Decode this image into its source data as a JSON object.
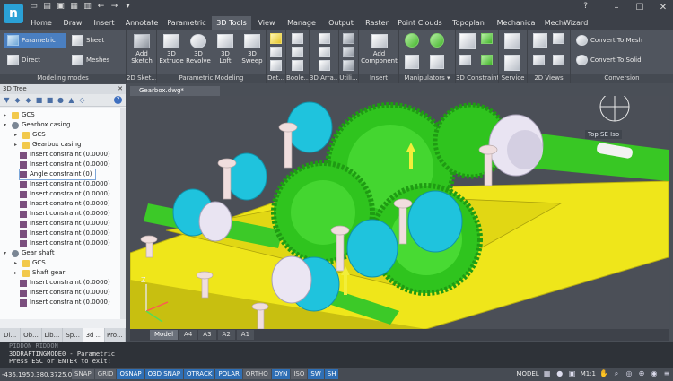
{
  "title_bar": {
    "help_label": "?",
    "qat_icons": [
      "new-file-icon",
      "open-icon",
      "save-icon",
      "save-as-icon",
      "print-icon",
      "undo-icon",
      "redo-icon",
      "dropdown-icon"
    ]
  },
  "tabs": [
    {
      "label": "Home"
    },
    {
      "label": "Draw"
    },
    {
      "label": "Insert"
    },
    {
      "label": "Annotate"
    },
    {
      "label": "Parametric"
    },
    {
      "label": "3D Tools"
    },
    {
      "label": "View"
    },
    {
      "label": "Manage"
    },
    {
      "label": "Output"
    },
    {
      "label": "Raster"
    },
    {
      "label": "Point Clouds"
    },
    {
      "label": "Topoplan"
    },
    {
      "label": "Mechanica"
    },
    {
      "label": "MechWizard"
    }
  ],
  "ribbon": {
    "modeling_modes": {
      "label": "Modeling modes",
      "parametric": "Parametric",
      "direct": "Direct",
      "sheet": "Sheet",
      "meshes": "Meshes"
    },
    "sketch": {
      "label": "2D Sket...",
      "add_sketch": "Add\nSketch"
    },
    "param_modeling": {
      "label": "Parametric Modeling",
      "extrude": "3D\nExtrude",
      "revolve": "3D\nRevolve",
      "loft": "3D\nLoft",
      "sweep": "3D\nSweep"
    },
    "detail": {
      "label": "Det..."
    },
    "boolean": {
      "label": "Boole..."
    },
    "array": {
      "label": "3D Arra..."
    },
    "util": {
      "label": "Utili..."
    },
    "insert": {
      "label": "Insert",
      "add_component": "Add\nComponent"
    },
    "manipulators": {
      "label": "Manipulators"
    },
    "constraint": {
      "label": "3D Constraint"
    },
    "service": {
      "label": "Service"
    },
    "views": {
      "label": "2D Views"
    },
    "conversion": {
      "label": "Conversion",
      "to_mesh": "Convert To Mesh",
      "to_solid": "Convert To Solid"
    }
  },
  "left_panel": {
    "title": "3D Tree",
    "tree": [
      {
        "label": "GCS",
        "icon": "folder"
      },
      {
        "label": "Gearbox casing",
        "icon": "gear"
      },
      {
        "label": "GCS",
        "icon": "folder"
      },
      {
        "label": "Gearbox casing",
        "icon": "folder"
      },
      {
        "label": "Insert constraint (0.0000)",
        "icon": "cons"
      },
      {
        "label": "Insert constraint (0.0000)",
        "icon": "cons"
      },
      {
        "label": "Angle constraint (0)",
        "icon": "cons"
      },
      {
        "label": "Insert constraint (0.0000)",
        "icon": "cons"
      },
      {
        "label": "Insert constraint (0.0000)",
        "icon": "cons"
      },
      {
        "label": "Insert constraint (0.0000)",
        "icon": "cons"
      },
      {
        "label": "Insert constraint (0.0000)",
        "icon": "cons"
      },
      {
        "label": "Insert constraint (0.0000)",
        "icon": "cons"
      },
      {
        "label": "Insert constraint (0.0000)",
        "icon": "cons"
      },
      {
        "label": "Insert constraint (0.0000)",
        "icon": "cons"
      },
      {
        "label": "Gear shaft",
        "icon": "gear"
      },
      {
        "label": "GCS",
        "icon": "folder"
      },
      {
        "label": "Shaft gear",
        "icon": "folder"
      },
      {
        "label": "Insert constraint (0.0000)",
        "icon": "cons"
      },
      {
        "label": "Insert constraint (0.0000)",
        "icon": "cons"
      },
      {
        "label": "Insert constraint (0.0000)",
        "icon": "cons"
      }
    ],
    "bottom_tabs": [
      "Di...",
      "Ob...",
      "Lib...",
      "Sp...",
      "3d ...",
      "Pro..."
    ]
  },
  "document": {
    "tab_title": "Gearbox.dwg*",
    "view_label": "Top SE Iso",
    "layout_tabs": [
      "Model",
      "A4",
      "A3",
      "A2",
      "A1"
    ]
  },
  "command_line": {
    "faded": "PIDDON   RIDDON",
    "line1": "3DDRAFTINGMODE0 - Parametric",
    "line2": "Press ESC or ENTER to exit:"
  },
  "status_bar": {
    "coords": "-436.1950,380.3725,0.00",
    "toggles": [
      {
        "label": "SNAP",
        "on": false
      },
      {
        "label": "GRID",
        "on": false
      },
      {
        "label": "OSNAP",
        "on": true
      },
      {
        "label": "O3D SNAP",
        "on": true
      },
      {
        "label": "OTRACK",
        "on": true
      },
      {
        "label": "POLAR",
        "on": true
      },
      {
        "label": "ORTHO",
        "on": false
      },
      {
        "label": "DYN",
        "on": true
      },
      {
        "label": "ISO",
        "on": false
      },
      {
        "label": "SW",
        "on": true
      },
      {
        "label": "SH",
        "on": true
      }
    ],
    "model_label": "MODEL",
    "scale": "M1:1"
  },
  "colors": {
    "accent": "#2f6fb5",
    "gear_green": "#39d12c",
    "casing_yellow": "#f2ec1a",
    "bearing_cyan": "#22c6e0"
  }
}
